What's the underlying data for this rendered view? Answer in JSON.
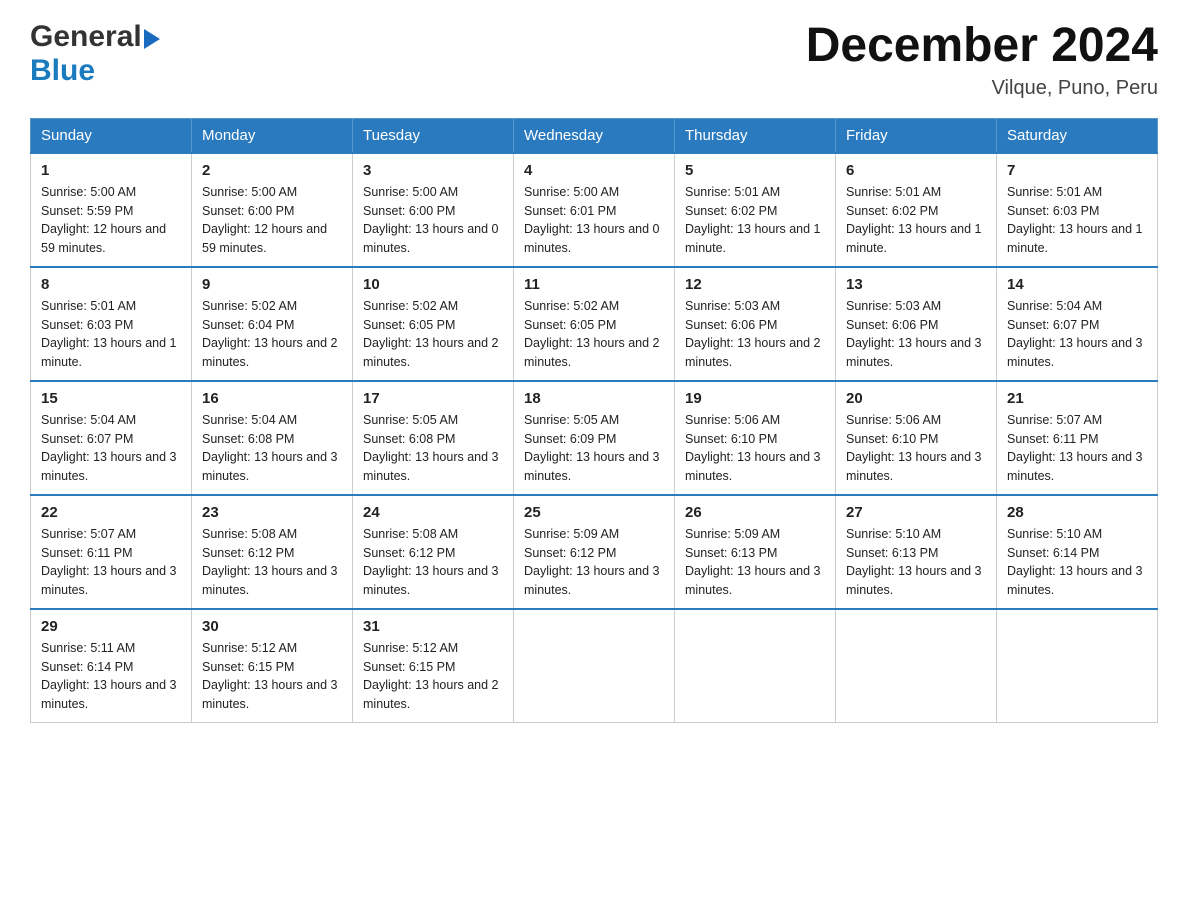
{
  "header": {
    "logo_general": "General",
    "logo_blue": "Blue",
    "title": "December 2024",
    "location": "Vilque, Puno, Peru"
  },
  "calendar": {
    "days_of_week": [
      "Sunday",
      "Monday",
      "Tuesday",
      "Wednesday",
      "Thursday",
      "Friday",
      "Saturday"
    ],
    "weeks": [
      [
        {
          "date": "1",
          "sunrise": "5:00 AM",
          "sunset": "5:59 PM",
          "daylight": "12 hours and 59 minutes."
        },
        {
          "date": "2",
          "sunrise": "5:00 AM",
          "sunset": "6:00 PM",
          "daylight": "12 hours and 59 minutes."
        },
        {
          "date": "3",
          "sunrise": "5:00 AM",
          "sunset": "6:00 PM",
          "daylight": "13 hours and 0 minutes."
        },
        {
          "date": "4",
          "sunrise": "5:00 AM",
          "sunset": "6:01 PM",
          "daylight": "13 hours and 0 minutes."
        },
        {
          "date": "5",
          "sunrise": "5:01 AM",
          "sunset": "6:02 PM",
          "daylight": "13 hours and 1 minute."
        },
        {
          "date": "6",
          "sunrise": "5:01 AM",
          "sunset": "6:02 PM",
          "daylight": "13 hours and 1 minute."
        },
        {
          "date": "7",
          "sunrise": "5:01 AM",
          "sunset": "6:03 PM",
          "daylight": "13 hours and 1 minute."
        }
      ],
      [
        {
          "date": "8",
          "sunrise": "5:01 AM",
          "sunset": "6:03 PM",
          "daylight": "13 hours and 1 minute."
        },
        {
          "date": "9",
          "sunrise": "5:02 AM",
          "sunset": "6:04 PM",
          "daylight": "13 hours and 2 minutes."
        },
        {
          "date": "10",
          "sunrise": "5:02 AM",
          "sunset": "6:05 PM",
          "daylight": "13 hours and 2 minutes."
        },
        {
          "date": "11",
          "sunrise": "5:02 AM",
          "sunset": "6:05 PM",
          "daylight": "13 hours and 2 minutes."
        },
        {
          "date": "12",
          "sunrise": "5:03 AM",
          "sunset": "6:06 PM",
          "daylight": "13 hours and 2 minutes."
        },
        {
          "date": "13",
          "sunrise": "5:03 AM",
          "sunset": "6:06 PM",
          "daylight": "13 hours and 3 minutes."
        },
        {
          "date": "14",
          "sunrise": "5:04 AM",
          "sunset": "6:07 PM",
          "daylight": "13 hours and 3 minutes."
        }
      ],
      [
        {
          "date": "15",
          "sunrise": "5:04 AM",
          "sunset": "6:07 PM",
          "daylight": "13 hours and 3 minutes."
        },
        {
          "date": "16",
          "sunrise": "5:04 AM",
          "sunset": "6:08 PM",
          "daylight": "13 hours and 3 minutes."
        },
        {
          "date": "17",
          "sunrise": "5:05 AM",
          "sunset": "6:08 PM",
          "daylight": "13 hours and 3 minutes."
        },
        {
          "date": "18",
          "sunrise": "5:05 AM",
          "sunset": "6:09 PM",
          "daylight": "13 hours and 3 minutes."
        },
        {
          "date": "19",
          "sunrise": "5:06 AM",
          "sunset": "6:10 PM",
          "daylight": "13 hours and 3 minutes."
        },
        {
          "date": "20",
          "sunrise": "5:06 AM",
          "sunset": "6:10 PM",
          "daylight": "13 hours and 3 minutes."
        },
        {
          "date": "21",
          "sunrise": "5:07 AM",
          "sunset": "6:11 PM",
          "daylight": "13 hours and 3 minutes."
        }
      ],
      [
        {
          "date": "22",
          "sunrise": "5:07 AM",
          "sunset": "6:11 PM",
          "daylight": "13 hours and 3 minutes."
        },
        {
          "date": "23",
          "sunrise": "5:08 AM",
          "sunset": "6:12 PM",
          "daylight": "13 hours and 3 minutes."
        },
        {
          "date": "24",
          "sunrise": "5:08 AM",
          "sunset": "6:12 PM",
          "daylight": "13 hours and 3 minutes."
        },
        {
          "date": "25",
          "sunrise": "5:09 AM",
          "sunset": "6:12 PM",
          "daylight": "13 hours and 3 minutes."
        },
        {
          "date": "26",
          "sunrise": "5:09 AM",
          "sunset": "6:13 PM",
          "daylight": "13 hours and 3 minutes."
        },
        {
          "date": "27",
          "sunrise": "5:10 AM",
          "sunset": "6:13 PM",
          "daylight": "13 hours and 3 minutes."
        },
        {
          "date": "28",
          "sunrise": "5:10 AM",
          "sunset": "6:14 PM",
          "daylight": "13 hours and 3 minutes."
        }
      ],
      [
        {
          "date": "29",
          "sunrise": "5:11 AM",
          "sunset": "6:14 PM",
          "daylight": "13 hours and 3 minutes."
        },
        {
          "date": "30",
          "sunrise": "5:12 AM",
          "sunset": "6:15 PM",
          "daylight": "13 hours and 3 minutes."
        },
        {
          "date": "31",
          "sunrise": "5:12 AM",
          "sunset": "6:15 PM",
          "daylight": "13 hours and 2 minutes."
        },
        null,
        null,
        null,
        null
      ]
    ]
  }
}
